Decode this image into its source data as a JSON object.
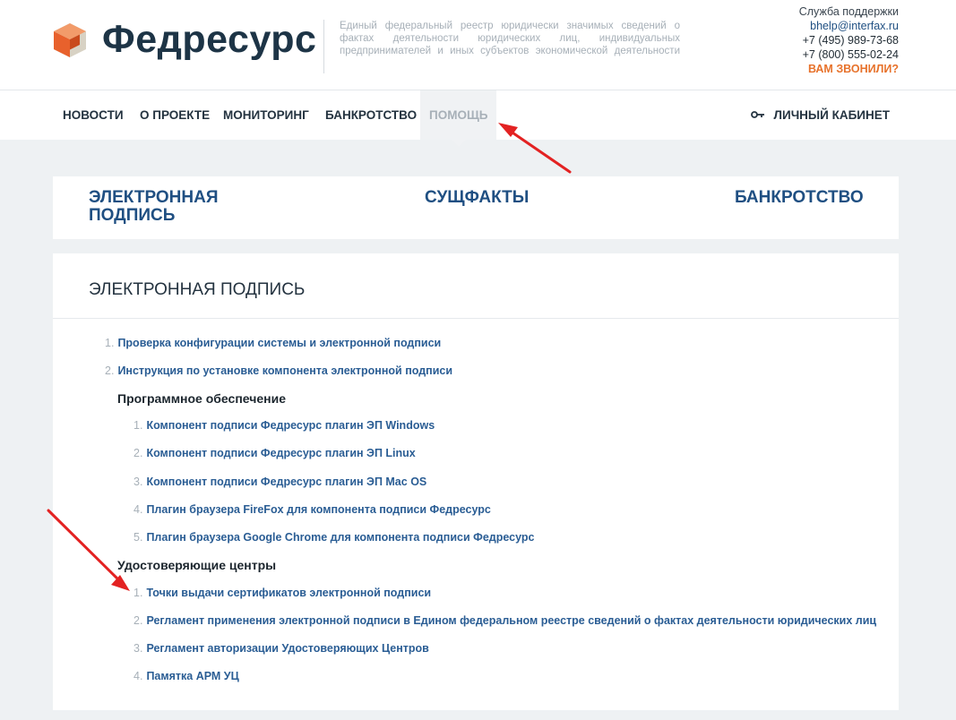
{
  "header": {
    "brand": "Федресурс",
    "tagline": "Единый федеральный реестр юридически значимых сведений о фактах деятельности юридических лиц, индивидуальных предпринимателей и иных субъектов экономической деятельности",
    "support_label": "Служба поддержки",
    "support_email": "bhelp@interfax.ru",
    "phone_1": "+7 (495) 989-73-68",
    "phone_2": "+7 (800) 555-02-24",
    "callback": "ВАМ ЗВОНИЛИ?",
    "logo_colors": [
      "#e8612c",
      "#f29b6a",
      "#c94a1c",
      "#d8d2c4"
    ]
  },
  "nav": {
    "items": [
      {
        "label": "НОВОСТИ"
      },
      {
        "label": "О ПРОЕКТЕ"
      },
      {
        "label": "МОНИТОРИНГ"
      },
      {
        "label": "БАНКРОТСТВО"
      },
      {
        "label": "ПОМОЩЬ",
        "active": true
      }
    ],
    "cabinet": "ЛИЧНЫЙ КАБИНЕТ",
    "cabinet_icon": "key-icon"
  },
  "categories": [
    {
      "label": "ЭЛЕКТРОННАЯ ПОДПИСЬ"
    },
    {
      "label": "СУЩФАКТЫ"
    },
    {
      "label": "БАНКРОТСТВО"
    }
  ],
  "section": {
    "title": "ЭЛЕКТРОННАЯ ПОДПИСЬ",
    "top_items": [
      {
        "num": "1.",
        "label": "Проверка конфигурации системы и электронной подписи"
      },
      {
        "num": "2.",
        "label": "Инструкция по установке компонента электронной подписи"
      }
    ],
    "software_heading": "Программное обеспечение",
    "software_items": [
      {
        "num": "1.",
        "label": "Компонент подписи Федресурс плагин ЭП Windows"
      },
      {
        "num": "2.",
        "label": "Компонент подписи Федресурс плагин ЭП Linux"
      },
      {
        "num": "3.",
        "label": "Компонент подписи Федресурс плагин ЭП Mac OS"
      },
      {
        "num": "4.",
        "label": "Плагин браузера FireFox для компонента подписи Федресурс"
      },
      {
        "num": "5.",
        "label": "Плагин браузера Google Chrome для компонента подписи Федресурс"
      }
    ],
    "ca_heading": "Удостоверяющие центры",
    "ca_items": [
      {
        "num": "1.",
        "label": "Точки выдачи сертификатов электронной подписи"
      },
      {
        "num": "2.",
        "label": "Регламент применения электронной подписи в Едином федеральном реестре сведений о фактах деятельности юридических лиц"
      },
      {
        "num": "3.",
        "label": "Регламент авторизации Удостоверяющих Центров"
      },
      {
        "num": "4.",
        "label": "Памятка АРМ УЦ"
      }
    ]
  },
  "colors": {
    "link": "#2a5d94",
    "accent_orange": "#e7722b",
    "annotation_red": "#e32222"
  }
}
